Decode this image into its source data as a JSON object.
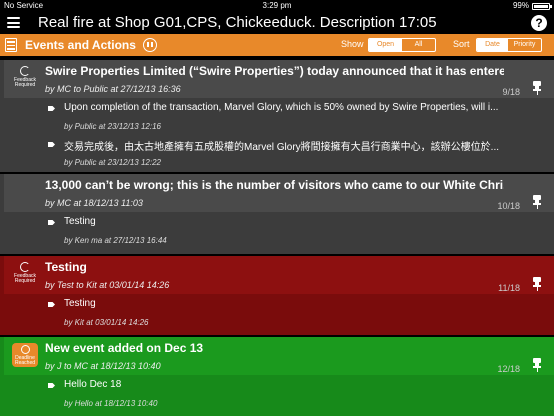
{
  "status_bar": {
    "carrier": "No Service",
    "time": "3:29 pm",
    "battery_percent": "99%",
    "battery_level": 0.99
  },
  "header": {
    "title": "Real fire at Shop G01,CPS, Chickeeduck. Description 17:05",
    "help_label": "?"
  },
  "toolbar": {
    "section_title": "Events and Actions",
    "show_label": "Show",
    "show_options": [
      "Open",
      "All"
    ],
    "show_selected": "All",
    "sort_label": "Sort",
    "sort_options": [
      "Date",
      "Priority"
    ],
    "sort_selected": "Priority"
  },
  "events": [
    {
      "color": "#4a4a4a",
      "badge": "Feedback Required",
      "title": "Swire Properties Limited (“Swire Properties”) today announced that it has entere...",
      "meta": "by MC to Public at 27/12/13 16:36",
      "count": "9/18",
      "replies": [
        {
          "text": "Upon completion of the transaction, Marvel Glory, which is 50% owned by Swire Properties, will i...",
          "meta": "by Public at 23/12/13 12:16"
        },
        {
          "text": "交易完成後，由太古地產擁有五成股權的Marvel Glory將間接擁有大昌行商業中心，該辦公樓位於...",
          "meta": "by Public at 23/12/13 12:22"
        }
      ]
    },
    {
      "color": "#4a4a4a",
      "badge": "",
      "title": "13,000 can’t be wrong; this is the number of visitors who came to our White Chri...",
      "meta": "by MC at 18/12/13 11:03",
      "count": "10/18",
      "replies": [
        {
          "text": "Testing",
          "meta": "by Ken ma at 27/12/13 16:44"
        }
      ]
    },
    {
      "color": "#8d1010",
      "badge": "Feedback Required",
      "title": "Testing",
      "meta": "by Test to Kit at 03/01/14 14:26",
      "count": "11/18",
      "replies": [
        {
          "text": "Testing",
          "meta": "by Kit at 03/01/14 14:26"
        }
      ]
    },
    {
      "color": "#1b9a1e",
      "badge": "Deadline Reached",
      "title": "New event added on Dec 13",
      "meta": "by J to MC at 18/12/13 10:40",
      "count": "12/18",
      "replies": [
        {
          "text": "Hello Dec 18",
          "meta": "by Hello at 18/12/13 10:40"
        }
      ]
    }
  ]
}
